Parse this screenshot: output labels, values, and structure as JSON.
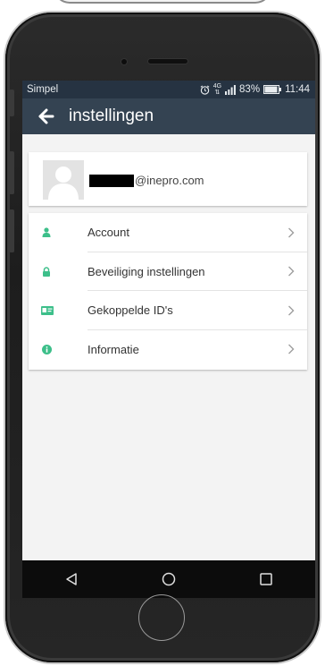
{
  "statusbar": {
    "carrier": "Simpel",
    "network": "4G",
    "battery": "83%",
    "time": "11:44"
  },
  "appbar": {
    "title": "instellingen"
  },
  "profile": {
    "email_suffix": "@inepro.com"
  },
  "menu": {
    "items": [
      {
        "label": "Account",
        "icon": "person-icon"
      },
      {
        "label": "Beveiliging instellingen",
        "icon": "lock-icon"
      },
      {
        "label": "Gekoppelde ID's",
        "icon": "id-card-icon"
      },
      {
        "label": "Informatie",
        "icon": "info-icon"
      }
    ]
  },
  "colors": {
    "accent": "#3dbf8a",
    "appbar": "#344352",
    "statusbar": "#263342"
  }
}
